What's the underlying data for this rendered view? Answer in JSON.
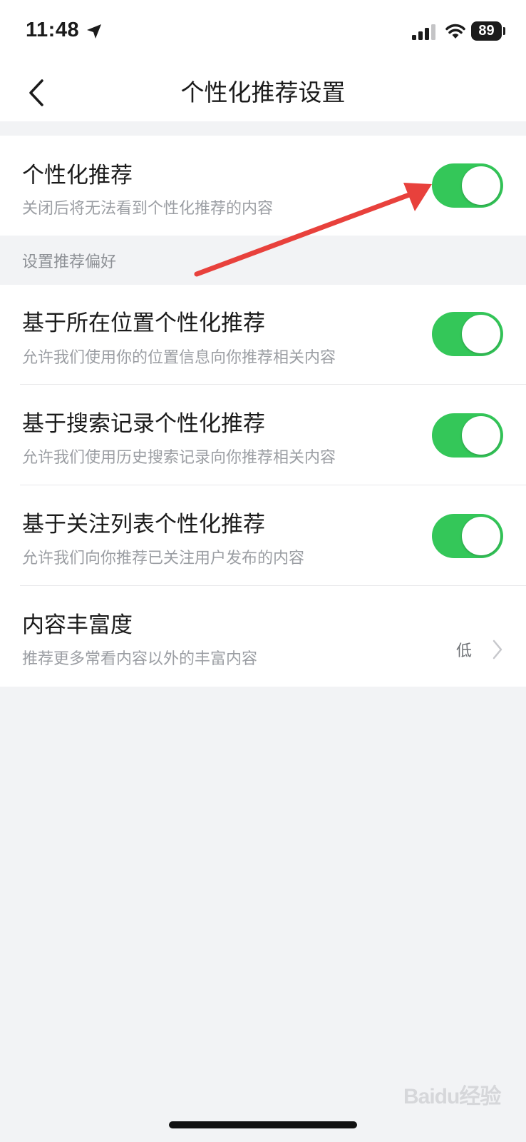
{
  "status_bar": {
    "time": "11:48",
    "battery": "89",
    "icons": [
      "location-arrow-icon",
      "signal-icon",
      "wifi-icon",
      "battery-icon"
    ]
  },
  "nav": {
    "title": "个性化推荐设置",
    "back_icon": "chevron-left-icon"
  },
  "master": {
    "title": "个性化推荐",
    "description": "关闭后将无法看到个性化推荐的内容",
    "enabled": true
  },
  "preferences": {
    "header": "设置推荐偏好",
    "items": [
      {
        "title": "基于所在位置个性化推荐",
        "description": "允许我们使用你的位置信息向你推荐相关内容",
        "enabled": true
      },
      {
        "title": "基于搜索记录个性化推荐",
        "description": "允许我们使用历史搜索记录向你推荐相关内容",
        "enabled": true
      },
      {
        "title": "基于关注列表个性化推荐",
        "description": "允许我们向你推荐已关注用户发布的内容",
        "enabled": true
      }
    ],
    "richness": {
      "title": "内容丰富度",
      "description": "推荐更多常看内容以外的丰富内容",
      "value": "低"
    }
  },
  "watermark": "Baidu经验",
  "colors": {
    "toggle_on": "#34c759",
    "background": "#f2f3f5",
    "annotation_arrow": "#e8413c"
  }
}
